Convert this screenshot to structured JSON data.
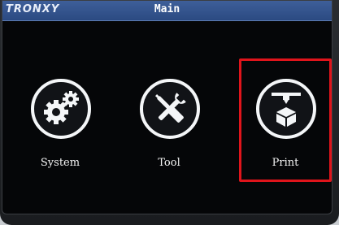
{
  "header": {
    "brand": "TRONXY",
    "title": "Main"
  },
  "menu": [
    {
      "label": "System",
      "icon": "gears-icon"
    },
    {
      "label": "Tool",
      "icon": "wrench-screwdriver-icon"
    },
    {
      "label": "Print",
      "icon": "printer-nozzle-cube-icon"
    }
  ],
  "selected": "Print",
  "colors": {
    "header_bg": "#2b4a82",
    "screen_bg": "#050608",
    "icon_stroke": "#f4f6f8",
    "highlight": "#e0141b"
  }
}
